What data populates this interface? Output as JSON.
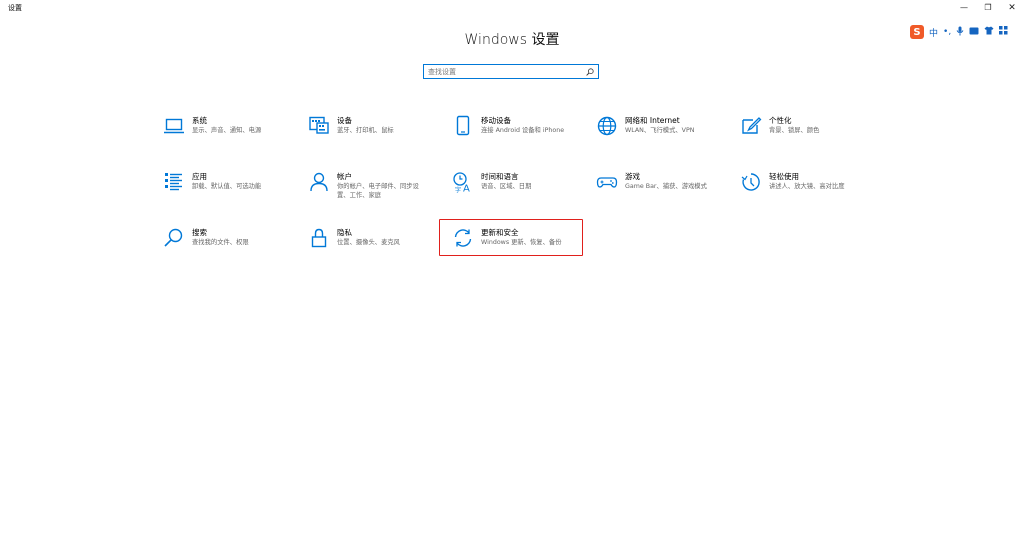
{
  "window": {
    "title": "设置",
    "minimize_glyph": "—",
    "maximize_glyph": "❐",
    "close_glyph": "✕"
  },
  "ime": {
    "logo": "S",
    "items": [
      "中",
      "•,",
      "🎤",
      "⌨",
      "👕",
      "⁘"
    ]
  },
  "page_title": "Windows 设置",
  "search": {
    "placeholder": "查找设置",
    "icon": "search-icon"
  },
  "accent_color": "#0078d7",
  "highlight_color": "#e0201c",
  "tiles": [
    {
      "title": "系统",
      "desc": "显示、声音、通知、电源",
      "icon": "laptop-icon"
    },
    {
      "title": "设备",
      "desc": "蓝牙、打印机、鼠标",
      "icon": "keyboard-icon"
    },
    {
      "title": "移动设备",
      "desc": "连接 Android 设备和 iPhone",
      "icon": "phone-icon"
    },
    {
      "title": "网络和 Internet",
      "desc": "WLAN、飞行模式、VPN",
      "icon": "globe-icon"
    },
    {
      "title": "个性化",
      "desc": "背景、锁屏、颜色",
      "icon": "paint-icon"
    },
    {
      "title": "应用",
      "desc": "卸载、默认值、可选功能",
      "icon": "apps-list-icon"
    },
    {
      "title": "帐户",
      "desc": "你的帐户、电子邮件、同步设\n置、工作、家庭",
      "icon": "person-icon"
    },
    {
      "title": "时间和语言",
      "desc": "语音、区域、日期",
      "icon": "time-language-icon"
    },
    {
      "title": "游戏",
      "desc": "Game Bar、捕获、游戏模式",
      "icon": "gamepad-icon"
    },
    {
      "title": "轻松使用",
      "desc": "讲述人、放大镜、高对比度",
      "icon": "ease-of-access-icon"
    },
    {
      "title": "搜索",
      "desc": "查找我的文件、权限",
      "icon": "search-icon"
    },
    {
      "title": "隐私",
      "desc": "位置、摄像头、麦克风",
      "icon": "lock-icon"
    },
    {
      "title": "更新和安全",
      "desc": "Windows 更新、恢复、备份",
      "icon": "sync-icon"
    }
  ]
}
